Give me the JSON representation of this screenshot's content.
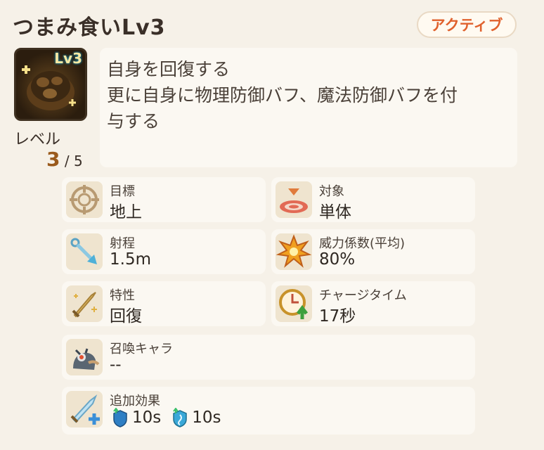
{
  "header": {
    "title": "つまみ食いLv3",
    "type_badge": "アクティブ"
  },
  "skill": {
    "icon_level_tag": "Lv3",
    "level_label": "レベル",
    "level_current": "3",
    "level_max": "/ 5",
    "description": [
      "自身を回復する",
      "更に自身に物理防御バフ、魔法防御バフを付",
      "与する"
    ]
  },
  "stats": {
    "target": {
      "label": "目標",
      "value": "地上",
      "icon": "crosshair-icon"
    },
    "scope": {
      "label": "対象",
      "value": "単体",
      "icon": "target-disc-icon"
    },
    "range": {
      "label": "射程",
      "value": "1.5m",
      "icon": "arrow-range-icon"
    },
    "power": {
      "label": "威力係数(平均)",
      "value": "80%",
      "icon": "burst-icon"
    },
    "trait": {
      "label": "特性",
      "value": "回復",
      "icon": "sword-sparkle-icon"
    },
    "charge": {
      "label": "チャージタイム",
      "value": "17秒",
      "icon": "clock-up-icon"
    },
    "summon": {
      "label": "召喚キャラ",
      "value": "--",
      "icon": "creature-icon"
    },
    "extra": {
      "label": "追加効果",
      "icon": "sword-plus-icon",
      "effects": [
        {
          "icon": "physical-defense-up-icon",
          "duration": "10s"
        },
        {
          "icon": "magic-defense-up-icon",
          "duration": "10s"
        }
      ]
    }
  },
  "colors": {
    "accent": "#e0612d",
    "panel": "#fbf8f2",
    "background": "#f6f1e8",
    "level_highlight": "#9a5a1c"
  }
}
